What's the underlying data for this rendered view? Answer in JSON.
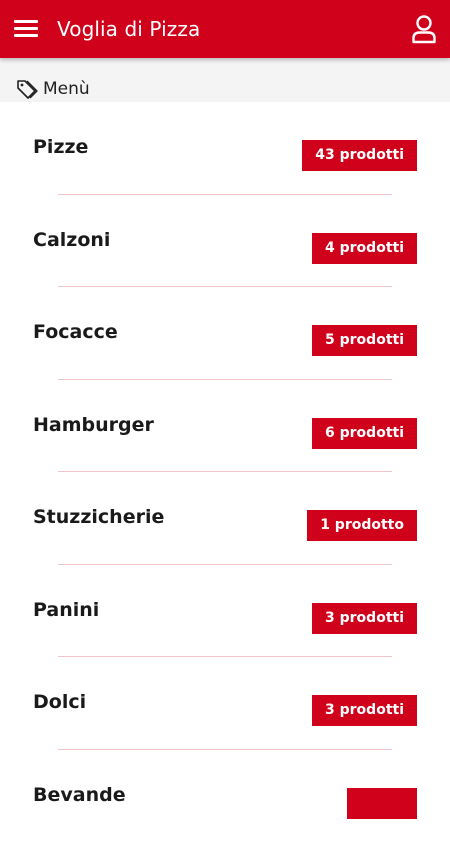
{
  "header": {
    "title": "Voglia di Pizza"
  },
  "section": {
    "label": "Menù"
  },
  "categories": [
    {
      "name": "Pizze",
      "count": "43 prodotti"
    },
    {
      "name": "Calzoni",
      "count": "4 prodotti"
    },
    {
      "name": "Focacce",
      "count": "5 prodotti"
    },
    {
      "name": "Hamburger",
      "count": "6 prodotti"
    },
    {
      "name": "Stuzzicherie",
      "count": "1 prodotto"
    },
    {
      "name": "Panini",
      "count": "3 prodotti"
    },
    {
      "name": "Dolci",
      "count": "3 prodotti"
    },
    {
      "name": "Bevande",
      "count": ""
    }
  ],
  "colors": {
    "accent": "#d0021b",
    "separator": "#f1c4c9",
    "section_bg": "#f4f4f4"
  },
  "icons": {
    "menu": "hamburger-menu-icon",
    "user": "user-icon",
    "tag": "tag-icon"
  }
}
